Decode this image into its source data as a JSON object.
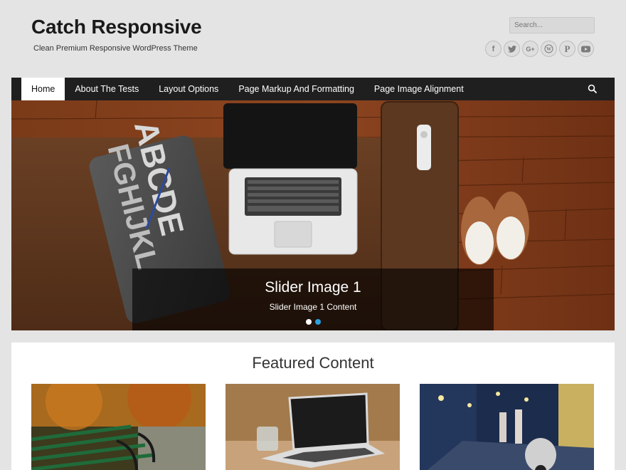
{
  "header": {
    "site_title": "Catch Responsive",
    "site_description": "Clean Premium Responsive WordPress Theme",
    "search_placeholder": "Search..."
  },
  "social": [
    {
      "icon": "facebook-icon",
      "glyph": "f"
    },
    {
      "icon": "twitter-icon",
      "glyph": "t"
    },
    {
      "icon": "google-plus-icon",
      "glyph": "G+"
    },
    {
      "icon": "wordpress-icon",
      "glyph": "W"
    },
    {
      "icon": "pinterest-icon",
      "glyph": "P"
    },
    {
      "icon": "youtube-icon",
      "glyph": "▶"
    }
  ],
  "nav": {
    "items": [
      {
        "label": "Home",
        "active": true
      },
      {
        "label": "About The Tests",
        "active": false
      },
      {
        "label": "Layout Options",
        "active": false
      },
      {
        "label": "Page Markup And Formatting",
        "active": false
      },
      {
        "label": "Page Image Alignment",
        "active": false
      }
    ],
    "search_icon": "search-icon"
  },
  "slider": {
    "title": "Slider Image 1",
    "content": "Slider Image 1 Content",
    "slide_count": 2,
    "active_slide": 2
  },
  "featured": {
    "title": "Featured Content"
  },
  "colors": {
    "nav_bg": "#1f1f1f",
    "accent_dot": "#2da0e0",
    "page_bg": "#e4e4e4"
  }
}
